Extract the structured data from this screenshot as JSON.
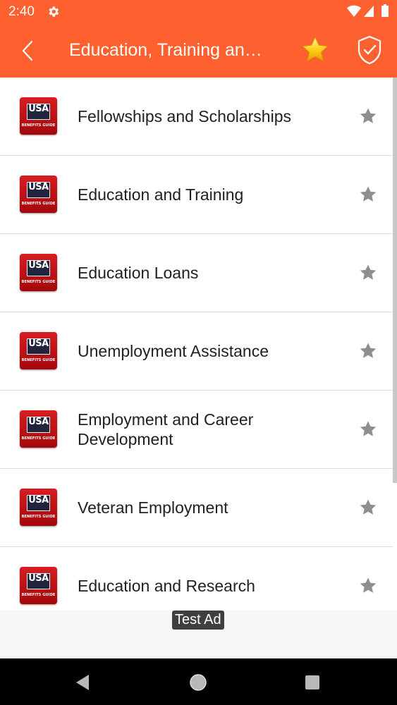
{
  "status_bar": {
    "time": "2:40",
    "icons": [
      "gear-icon",
      "wifi-icon",
      "signal-icon",
      "battery-icon"
    ]
  },
  "app_bar": {
    "title": "Education, Training an…",
    "background_color": "#fe612f",
    "icons": [
      "back-arrow-icon",
      "star-icon",
      "shield-check-icon"
    ]
  },
  "list": {
    "items": [
      {
        "label": "Fellowships and Scholarships",
        "logo_text": "USA",
        "logo_subtext": "BENEFITS GUIDE"
      },
      {
        "label": "Education and Training",
        "logo_text": "USA",
        "logo_subtext": "BENEFITS GUIDE"
      },
      {
        "label": "Education Loans",
        "logo_text": "USA",
        "logo_subtext": "BENEFITS GUIDE"
      },
      {
        "label": "Unemployment Assistance",
        "logo_text": "USA",
        "logo_subtext": "BENEFITS GUIDE"
      },
      {
        "label": "Employment and Career Development",
        "logo_text": "USA",
        "logo_subtext": "BENEFITS GUIDE"
      },
      {
        "label": "Veteran Employment",
        "logo_text": "USA",
        "logo_subtext": "BENEFITS GUIDE"
      },
      {
        "label": "Education and Research",
        "logo_text": "USA",
        "logo_subtext": "BENEFITS GUIDE"
      }
    ]
  },
  "ad": {
    "label": "Test Ad"
  },
  "nav_bar": {
    "icons": [
      "nav-back-icon",
      "nav-home-icon",
      "nav-recents-icon"
    ]
  }
}
